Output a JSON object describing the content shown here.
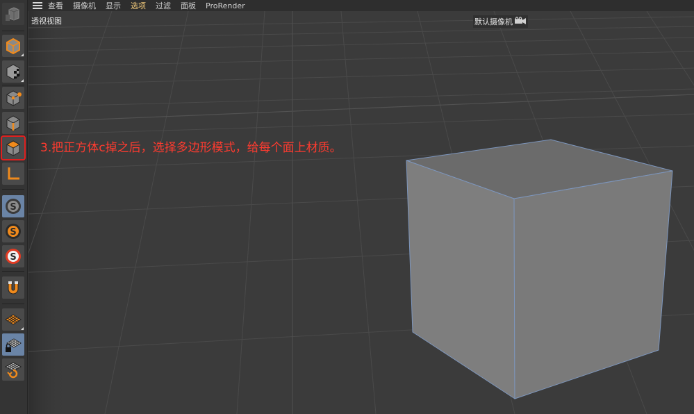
{
  "menubar": {
    "items": [
      {
        "label": "查看",
        "active": false
      },
      {
        "label": "摄像机",
        "active": false
      },
      {
        "label": "显示",
        "active": false
      },
      {
        "label": "选项",
        "active": true
      },
      {
        "label": "过滤",
        "active": false
      },
      {
        "label": "面板",
        "active": false
      },
      {
        "label": "ProRender",
        "active": false
      }
    ]
  },
  "viewport": {
    "view_label": "透视视图",
    "camera_label": "默认摄像机",
    "annotation": "3.把正方体c掉之后，选择多边形模式，给每个面上材质。"
  },
  "toolbar": {
    "tools": [
      {
        "name": "undo-view-icon"
      },
      {
        "name": "model-mode-icon"
      },
      {
        "name": "texture-mode-icon"
      },
      {
        "name": "point-mode-icon"
      },
      {
        "name": "edge-mode-icon"
      },
      {
        "name": "polygon-mode-icon",
        "highlighted": true
      },
      {
        "name": "axis-mode-icon"
      },
      {
        "name": "solo-off-icon",
        "selected": true
      },
      {
        "name": "solo-single-icon"
      },
      {
        "name": "solo-hierarchy-icon"
      },
      {
        "name": "snap-magnet-icon"
      },
      {
        "name": "workplane-icon"
      },
      {
        "name": "locked-workplane-icon",
        "selected": true
      },
      {
        "name": "workplane-align-icon"
      }
    ]
  },
  "colors": {
    "accent_orange": "#f08a1c",
    "annotation_red": "#ff3b2f",
    "highlight_outline": "#e0201f",
    "active_menu": "#f0c87a",
    "selected_tool": "#6a84a6"
  }
}
